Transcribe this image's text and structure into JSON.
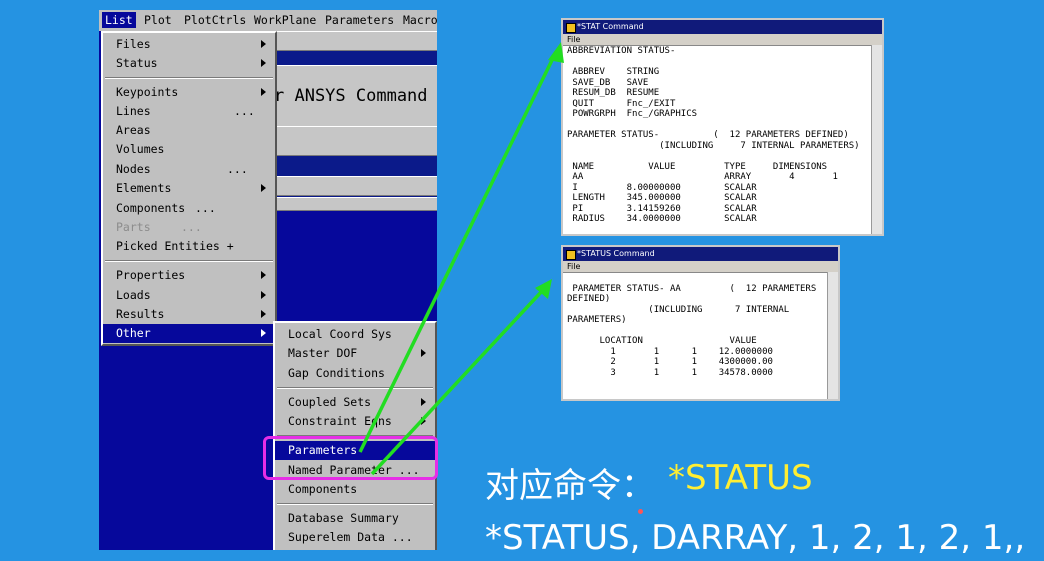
{
  "menubar": [
    "List",
    "Plot",
    "PlotCtrls",
    "WorkPlane",
    "Parameters",
    "Macro"
  ],
  "background_label": "r ANSYS Command",
  "list_menu": {
    "group1": [
      "Files",
      "Status"
    ],
    "group2": [
      "Keypoints",
      "Lines",
      "Areas",
      "Volumes",
      "Nodes",
      "Elements",
      "Components",
      "Parts",
      "Picked Entities +"
    ],
    "lines_suffix": "...",
    "nodes_suffix": "...",
    "components_suffix": "...",
    "parts_suffix": "...",
    "group3": [
      "Properties",
      "Loads",
      "Results",
      "Other"
    ]
  },
  "other_menu": {
    "group1": [
      "Local Coord Sys",
      "Master DOF",
      "Gap Conditions"
    ],
    "group2": [
      "Coupled Sets",
      "Constraint Eqns"
    ],
    "group3": [
      "Parameters",
      "Named Parameter ...",
      "Components"
    ],
    "group4": [
      "Database Summary",
      "Superelem Data ..."
    ]
  },
  "window1": {
    "title": "*STAT    Command",
    "menu": "File",
    "lines": [
      "ABBREVIATION STATUS-",
      "",
      " ABBREV    STRING",
      " SAVE_DB   SAVE",
      " RESUM_DB  RESUME",
      " QUIT      Fnc_/EXIT",
      " POWRGRPH  Fnc_/GRAPHICS",
      "",
      "PARAMETER STATUS-          (  12 PARAMETERS DEFINED)",
      "                 (INCLUDING     7 INTERNAL PARAMETERS)",
      "",
      " NAME          VALUE         TYPE     DIMENSIONS",
      " AA                          ARRAY       4       1       1",
      " I         8.00000000        SCALAR",
      " LENGTH    345.000000        SCALAR",
      " PI        3.14159260        SCALAR",
      " RADIUS    34.0000000        SCALAR"
    ]
  },
  "window2": {
    "title": "*STATUS  Command",
    "menu": "File",
    "lines": [
      "",
      " PARAMETER STATUS- AA         (  12 PARAMETERS",
      "DEFINED)",
      "               (INCLUDING      7 INTERNAL",
      "PARAMETERS)",
      "",
      "      LOCATION                VALUE",
      "        1       1      1    12.0000000",
      "        2       1      1    4300000.00",
      "        3       1      1    34578.0000"
    ]
  },
  "caption_prefix": "对应命令：",
  "caption_command": "*STATUS",
  "caption_line2": "*STATUS, DARRAY, 1, 2, 1, 2, 1,,",
  "colors": {
    "background": "#2593e2",
    "menu_selected": "#06089b",
    "highlight": "#e62ee6",
    "arrow": "#22dd22",
    "command": "#ffee33"
  }
}
